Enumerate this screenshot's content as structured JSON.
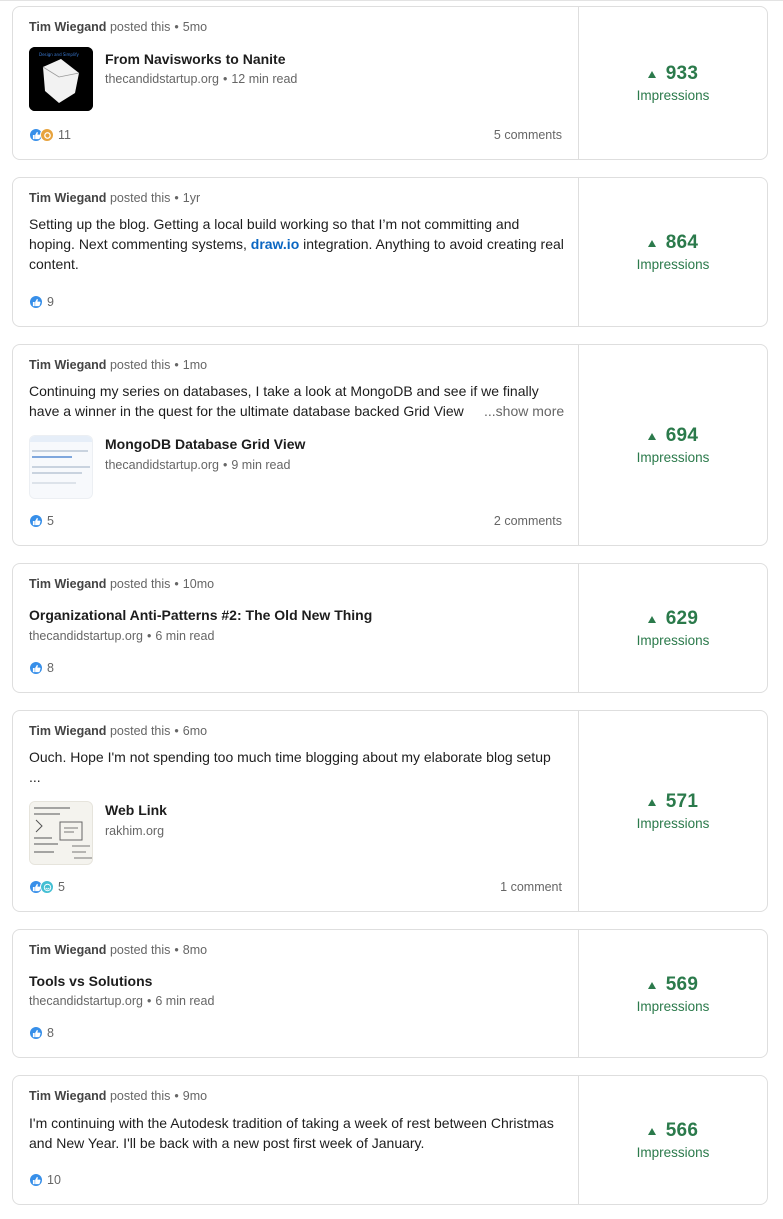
{
  "posts": [
    {
      "author": "Tim Wiegand",
      "action": "posted this",
      "age": "5mo",
      "article_title": "From Navisworks to Nanite",
      "article_domain": "thecandidstartup.org",
      "article_read": "12 min read",
      "reactions_count": "11",
      "comments": "5 comments",
      "impressions": "933",
      "impressions_label": "Impressions"
    },
    {
      "author": "Tim Wiegand",
      "action": "posted this",
      "age": "1yr",
      "text_before": "Setting up the blog. Getting a local build working so that I’m not committing and hoping. Next commenting systems, ",
      "text_link": "draw.io",
      "text_after": " integration. Anything to avoid creating real content.",
      "reactions_count": "9",
      "impressions": "864",
      "impressions_label": "Impressions"
    },
    {
      "author": "Tim Wiegand",
      "action": "posted this",
      "age": "1mo",
      "text_line1": "Continuing my series on databases, I take a look at MongoDB and see if we finally",
      "text_line2": "have a winner in the quest for the ultimate database backed Grid View",
      "show_more": "...show more",
      "article_title": "MongoDB Database Grid View",
      "article_domain": "thecandidstartup.org",
      "article_read": "9 min read",
      "reactions_count": "5",
      "comments": "2 comments",
      "impressions": "694",
      "impressions_label": "Impressions"
    },
    {
      "author": "Tim Wiegand",
      "action": "posted this",
      "age": "10mo",
      "article_title": "Organizational Anti-Patterns #2: The Old New Thing",
      "article_domain": "thecandidstartup.org",
      "article_read": "6 min read",
      "reactions_count": "8",
      "impressions": "629",
      "impressions_label": "Impressions"
    },
    {
      "author": "Tim Wiegand",
      "action": "posted this",
      "age": "6mo",
      "text": "Ouch. Hope I'm not spending too much time blogging about my elaborate blog setup ...",
      "article_title": "Web Link",
      "article_domain": "rakhim.org",
      "reactions_count": "5",
      "comments": "1 comment",
      "impressions": "571",
      "impressions_label": "Impressions"
    },
    {
      "author": "Tim Wiegand",
      "action": "posted this",
      "age": "8mo",
      "article_title": "Tools vs Solutions",
      "article_domain": "thecandidstartup.org",
      "article_read": "6 min read",
      "reactions_count": "8",
      "impressions": "569",
      "impressions_label": "Impressions"
    },
    {
      "author": "Tim Wiegand",
      "action": "posted this",
      "age": "9mo",
      "text": "I'm continuing with the Autodesk tradition of taking a week of rest between Christmas and New Year. I'll be back with a new post first week of January.",
      "reactions_count": "10",
      "impressions": "566",
      "impressions_label": "Impressions"
    }
  ],
  "icons": {
    "like": "like-reaction-icon",
    "celebrate": "celebrate-reaction-icon",
    "funny": "funny-reaction-icon",
    "up": "up-triangle-icon"
  },
  "colors": {
    "accent_green": "#2b7a4b",
    "link_blue": "#0a66c2",
    "like_blue": "#378fe9",
    "border": "#dedede"
  }
}
